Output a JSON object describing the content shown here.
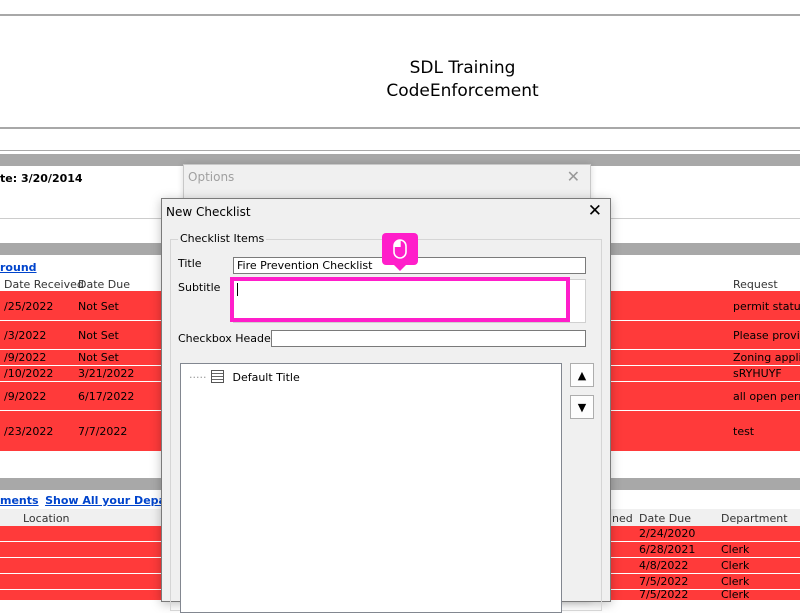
{
  "app": {
    "title_line1": "SDL Training",
    "title_line2": "CodeEnforcement"
  },
  "background": {
    "date_label": "te: 3/20/2014",
    "round_link": "round",
    "top_headers": {
      "date_received": "Date Received",
      "date_due": "Date Due",
      "request": "Request"
    },
    "top_rows": [
      {
        "received": "/25/2022",
        "due": "Not Set",
        "request": "permit status"
      },
      {
        "received": "/3/2022",
        "due": "Not Set",
        "request": "Please provid"
      },
      {
        "received": "/9/2022",
        "due": "Not Set",
        "request": "Zoning applica"
      },
      {
        "received": "/10/2022",
        "due": "3/21/2022",
        "request": "sRYHUYF"
      },
      {
        "received": "/9/2022",
        "due": "6/17/2022",
        "request": "all open perm"
      },
      {
        "received": "/23/2022",
        "due": "7/7/2022",
        "request": "test"
      }
    ],
    "bottom_links": {
      "departments": "ments",
      "show_all": "Show All your Departm"
    },
    "bottom_headers": {
      "location": "Location",
      "assigned": "ned",
      "date_due": "Date Due",
      "department": "Department"
    },
    "bottom_rows": [
      {
        "date_due": "2/24/2020",
        "department": ""
      },
      {
        "date_due": "6/28/2021",
        "department": "Clerk"
      },
      {
        "date_due": "4/8/2022",
        "department": "Clerk"
      },
      {
        "date_due": "7/5/2022",
        "department": "Clerk"
      },
      {
        "date_due": "7/5/2022",
        "department": "Clerk"
      }
    ]
  },
  "options_window": {
    "title": "Options",
    "close": "✕"
  },
  "dialog": {
    "title": "New Checklist",
    "close": "✕",
    "group_label": "Checklist Items",
    "title_label": "Title",
    "title_value": "Fire Prevention Checklist",
    "subtitle_label": "Subtitle",
    "subtitle_value": "",
    "checkbox_header_label": "Checkbox Header",
    "checkbox_header_value": "",
    "tree_items": [
      "Default Title"
    ],
    "up_arrow": "▲",
    "down_arrow": "▼"
  },
  "colors": {
    "row_red": "#ff3a3a",
    "highlight": "#ff1eca"
  }
}
